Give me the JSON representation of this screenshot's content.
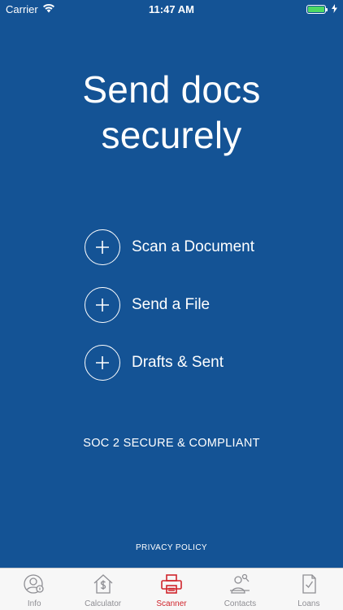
{
  "status_bar": {
    "carrier": "Carrier",
    "time": "11:47 AM",
    "wifi_icon": "wifi-icon",
    "battery_icon": "battery-icon",
    "battery_color": "#4cd964"
  },
  "main": {
    "headline_line1": "Send docs",
    "headline_line2": "securely",
    "background_color": "#145395",
    "actions": [
      {
        "label": "Scan a Document",
        "icon": "plus-circle-icon"
      },
      {
        "label": "Send a File",
        "icon": "plus-circle-icon"
      },
      {
        "label": "Drafts & Sent",
        "icon": "plus-circle-icon"
      }
    ],
    "compliance_text": "SOC 2 SECURE & COMPLIANT",
    "privacy_link": "PRIVACY POLICY"
  },
  "tab_bar": {
    "active_color": "#d0242b",
    "inactive_color": "#8e8e93",
    "active_tab": "Scanner",
    "tabs": [
      {
        "label": "Info",
        "icon": "user-info-icon"
      },
      {
        "label": "Calculator",
        "icon": "house-dollar-icon"
      },
      {
        "label": "Scanner",
        "icon": "printer-icon"
      },
      {
        "label": "Contacts",
        "icon": "contacts-icon"
      },
      {
        "label": "Loans",
        "icon": "document-check-icon"
      }
    ]
  }
}
